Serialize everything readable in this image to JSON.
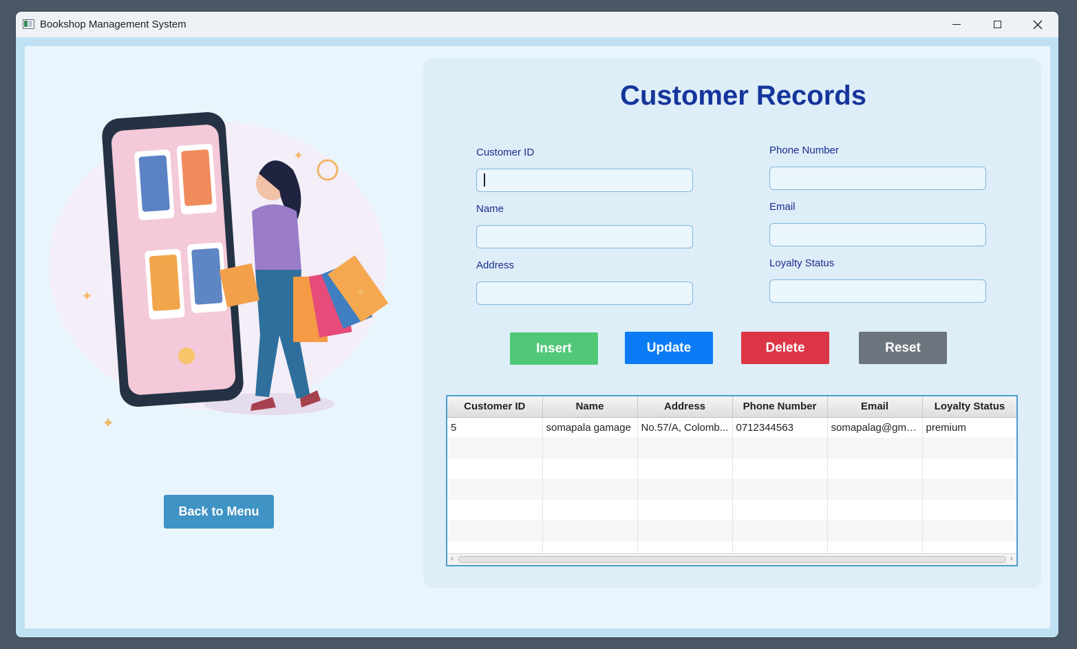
{
  "window": {
    "title": "Bookshop Management System"
  },
  "left": {
    "back_label": "Back to Menu"
  },
  "form": {
    "heading": "Customer Records",
    "fields": {
      "customer_id": {
        "label": "Customer ID",
        "value": ""
      },
      "name": {
        "label": "Name",
        "value": ""
      },
      "address": {
        "label": "Address",
        "value": ""
      },
      "phone": {
        "label": "Phone Number",
        "value": ""
      },
      "email": {
        "label": "Email",
        "value": ""
      },
      "loyalty": {
        "label": "Loyalty Status",
        "value": ""
      }
    },
    "buttons": {
      "insert": "Insert",
      "update": "Update",
      "delete": "Delete",
      "reset": "Reset"
    }
  },
  "table": {
    "columns": [
      "Customer ID",
      "Name",
      "Address",
      "Phone Number",
      "Email",
      "Loyalty Status"
    ],
    "rows": [
      [
        "5",
        "somapala gamage",
        "No.57/A, Colomb...",
        "0712344563",
        "somapalag@gma...",
        "premium"
      ]
    ]
  },
  "colors": {
    "heading": "#15359c",
    "insert": "#50c878",
    "update": "#0a7bf5",
    "delete": "#dc3545",
    "reset": "#6c757d",
    "back": "#3f93c5"
  }
}
